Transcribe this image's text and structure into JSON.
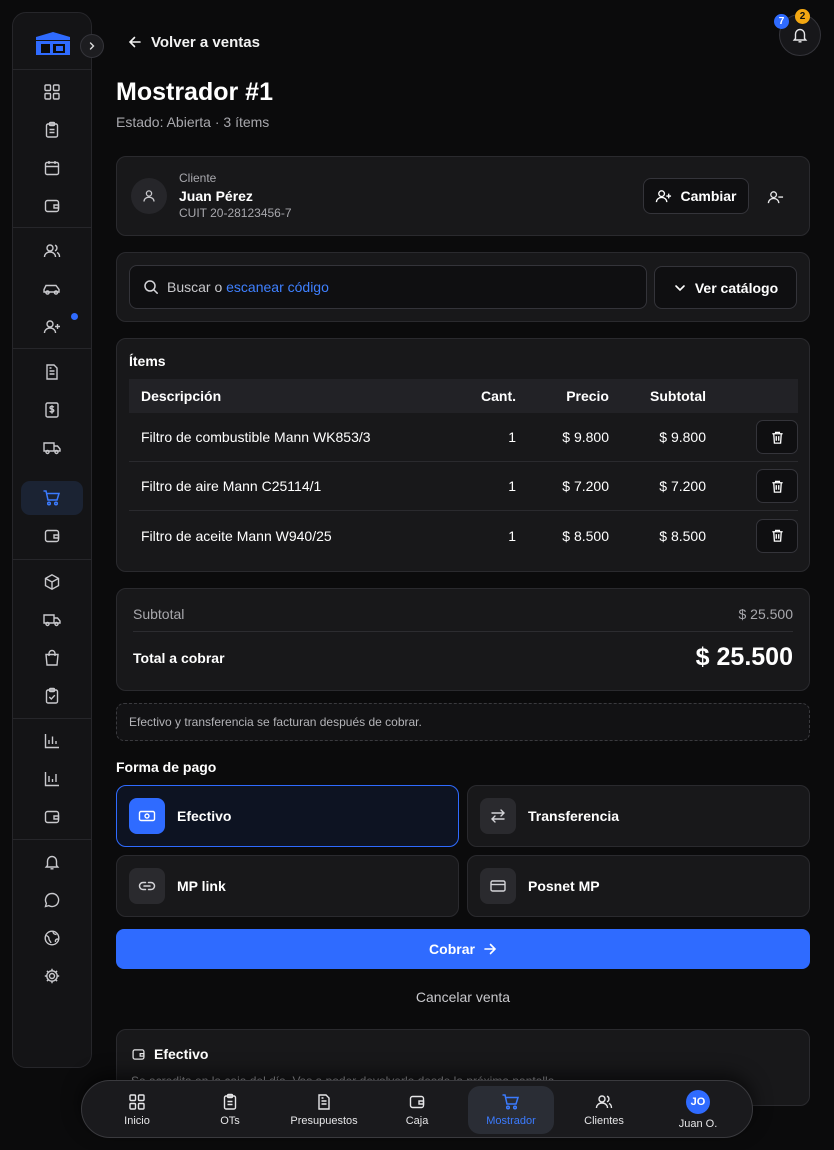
{
  "header": {
    "back_label": "Volver a ventas",
    "notifications": {
      "badge_blue": "7",
      "badge_orange": "2"
    },
    "title": "Mostrador #1",
    "subtitle": "Estado: Abierta · 3 ítems"
  },
  "sidebar": {
    "items": [
      {
        "icon": "grid-icon"
      },
      {
        "icon": "clipboard-icon"
      },
      {
        "icon": "calendar-icon"
      },
      {
        "icon": "wallet-icon"
      },
      {
        "icon": "users-icon"
      },
      {
        "icon": "car-icon"
      },
      {
        "icon": "user-plus-icon",
        "dot": true
      },
      {
        "icon": "document-icon"
      },
      {
        "icon": "dollar-doc-icon"
      },
      {
        "icon": "truck-icon"
      },
      {
        "icon": "cart-icon",
        "active": true
      },
      {
        "icon": "wallet-icon"
      },
      {
        "icon": "box-icon"
      },
      {
        "icon": "truck-icon"
      },
      {
        "icon": "bag-icon"
      },
      {
        "icon": "clipboard-check-icon"
      },
      {
        "icon": "bar-chart-icon"
      },
      {
        "icon": "bar-chart-icon"
      },
      {
        "icon": "wallet-icon"
      },
      {
        "icon": "bell-icon"
      },
      {
        "icon": "chat-icon"
      },
      {
        "icon": "globe-icon"
      },
      {
        "icon": "gear-icon"
      }
    ]
  },
  "client": {
    "label": "Cliente",
    "name": "Juan Pérez",
    "cuit": "CUIT 20-28123456-7",
    "change_label": "Cambiar"
  },
  "search": {
    "prefix": "Buscar o ",
    "link": "escanear código",
    "catalog_label": "Ver catálogo"
  },
  "items": {
    "title": "Ítems",
    "columns": [
      "Descripción",
      "Cant.",
      "Precio",
      "Subtotal"
    ],
    "rows": [
      {
        "desc": "Filtro de combustible Mann WK853/3",
        "qty": "1",
        "price": "$ 9.800",
        "subtotal": "$ 9.800"
      },
      {
        "desc": "Filtro de aire Mann C25114/1",
        "qty": "1",
        "price": "$ 7.200",
        "subtotal": "$ 7.200"
      },
      {
        "desc": "Filtro de aceite Mann W940/25",
        "qty": "1",
        "price": "$ 8.500",
        "subtotal": "$ 8.500"
      }
    ]
  },
  "totals": {
    "subtotal_label": "Subtotal",
    "subtotal_value": "$ 25.500",
    "total_label": "Total a cobrar",
    "total_value": "$ 25.500"
  },
  "notice": "Efectivo y transferencia se facturan después de cobrar.",
  "payment": {
    "label": "Forma de pago",
    "methods": [
      {
        "label": "Efectivo",
        "icon": "cash-icon",
        "selected": true
      },
      {
        "label": "Transferencia",
        "icon": "transfer-icon"
      },
      {
        "label": "MP link",
        "icon": "link-icon"
      },
      {
        "label": "Posnet MP",
        "icon": "card-icon"
      }
    ],
    "submit_label": "Cobrar",
    "cancel_label": "Cancelar venta"
  },
  "info": {
    "title": "Efectivo",
    "text": "Se acredita en la caja del día. Vas a poder devolverlo desde la próxima pantalla."
  },
  "bottom_nav": {
    "items": [
      {
        "label": "Inicio",
        "icon": "grid-icon"
      },
      {
        "label": "OTs",
        "icon": "clipboard-icon"
      },
      {
        "label": "Presupuestos",
        "icon": "document-icon"
      },
      {
        "label": "Caja",
        "icon": "wallet-icon"
      },
      {
        "label": "Mostrador",
        "icon": "cart-icon",
        "active": true
      },
      {
        "label": "Clientes",
        "icon": "users-icon"
      },
      {
        "label": "Juan O.",
        "avatar": "JO"
      }
    ]
  },
  "colors": {
    "accent": "#2f6bff",
    "badge_orange": "#f3a712",
    "background": "#0b0b0c",
    "card": "#18181a"
  }
}
